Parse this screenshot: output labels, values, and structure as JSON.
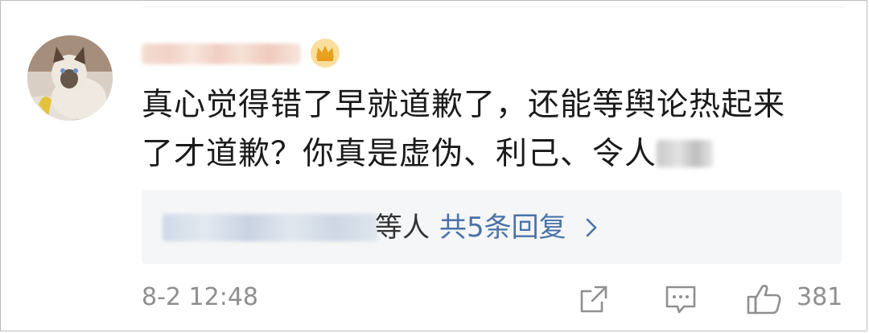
{
  "comment": {
    "line1": "真心觉得错了早就道歉了，还能等舆论热起来",
    "line2": "了才道歉？你真是虚伪、利己、令人"
  },
  "reply_summary": {
    "suffix": "等人",
    "count_label": "共5条回复"
  },
  "meta": {
    "timestamp": "8-2 12:48",
    "like_count": "381"
  },
  "colors": {
    "link": "#4a72a8",
    "muted": "#8f8f8f",
    "text": "#1a1a1a",
    "reply_bg": "#f5f6f8"
  },
  "icons": {
    "share": "share-icon",
    "comment": "comment-icon",
    "like": "thumbs-up-icon",
    "chevron": "chevron-right-icon",
    "badge": "crown-badge-icon"
  }
}
